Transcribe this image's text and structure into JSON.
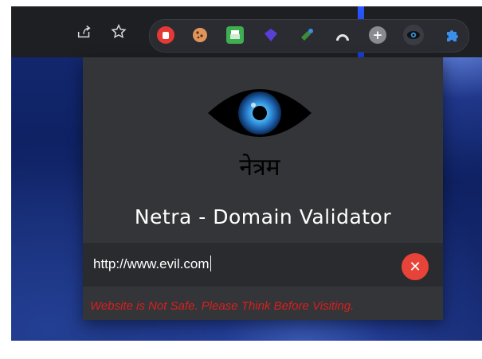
{
  "toolbar": {
    "icons": [
      "share-icon",
      "bookmark-star-icon",
      "block-hand-icon",
      "cookie-icon",
      "print-icon",
      "purple-gem-icon",
      "satellite-icon",
      "arch-icon",
      "plus-icon",
      "netra-eye-icon",
      "puzzle-icon"
    ]
  },
  "popup": {
    "logo_caption": "नेत्रम",
    "title": "Netra - Domain Validator",
    "input_value": "http://www.evil.com",
    "status_message": "Website is Not Safe. Please Think Before Visiting.",
    "status_color": "#d81f1f",
    "clear_button_color": "#e74338"
  }
}
